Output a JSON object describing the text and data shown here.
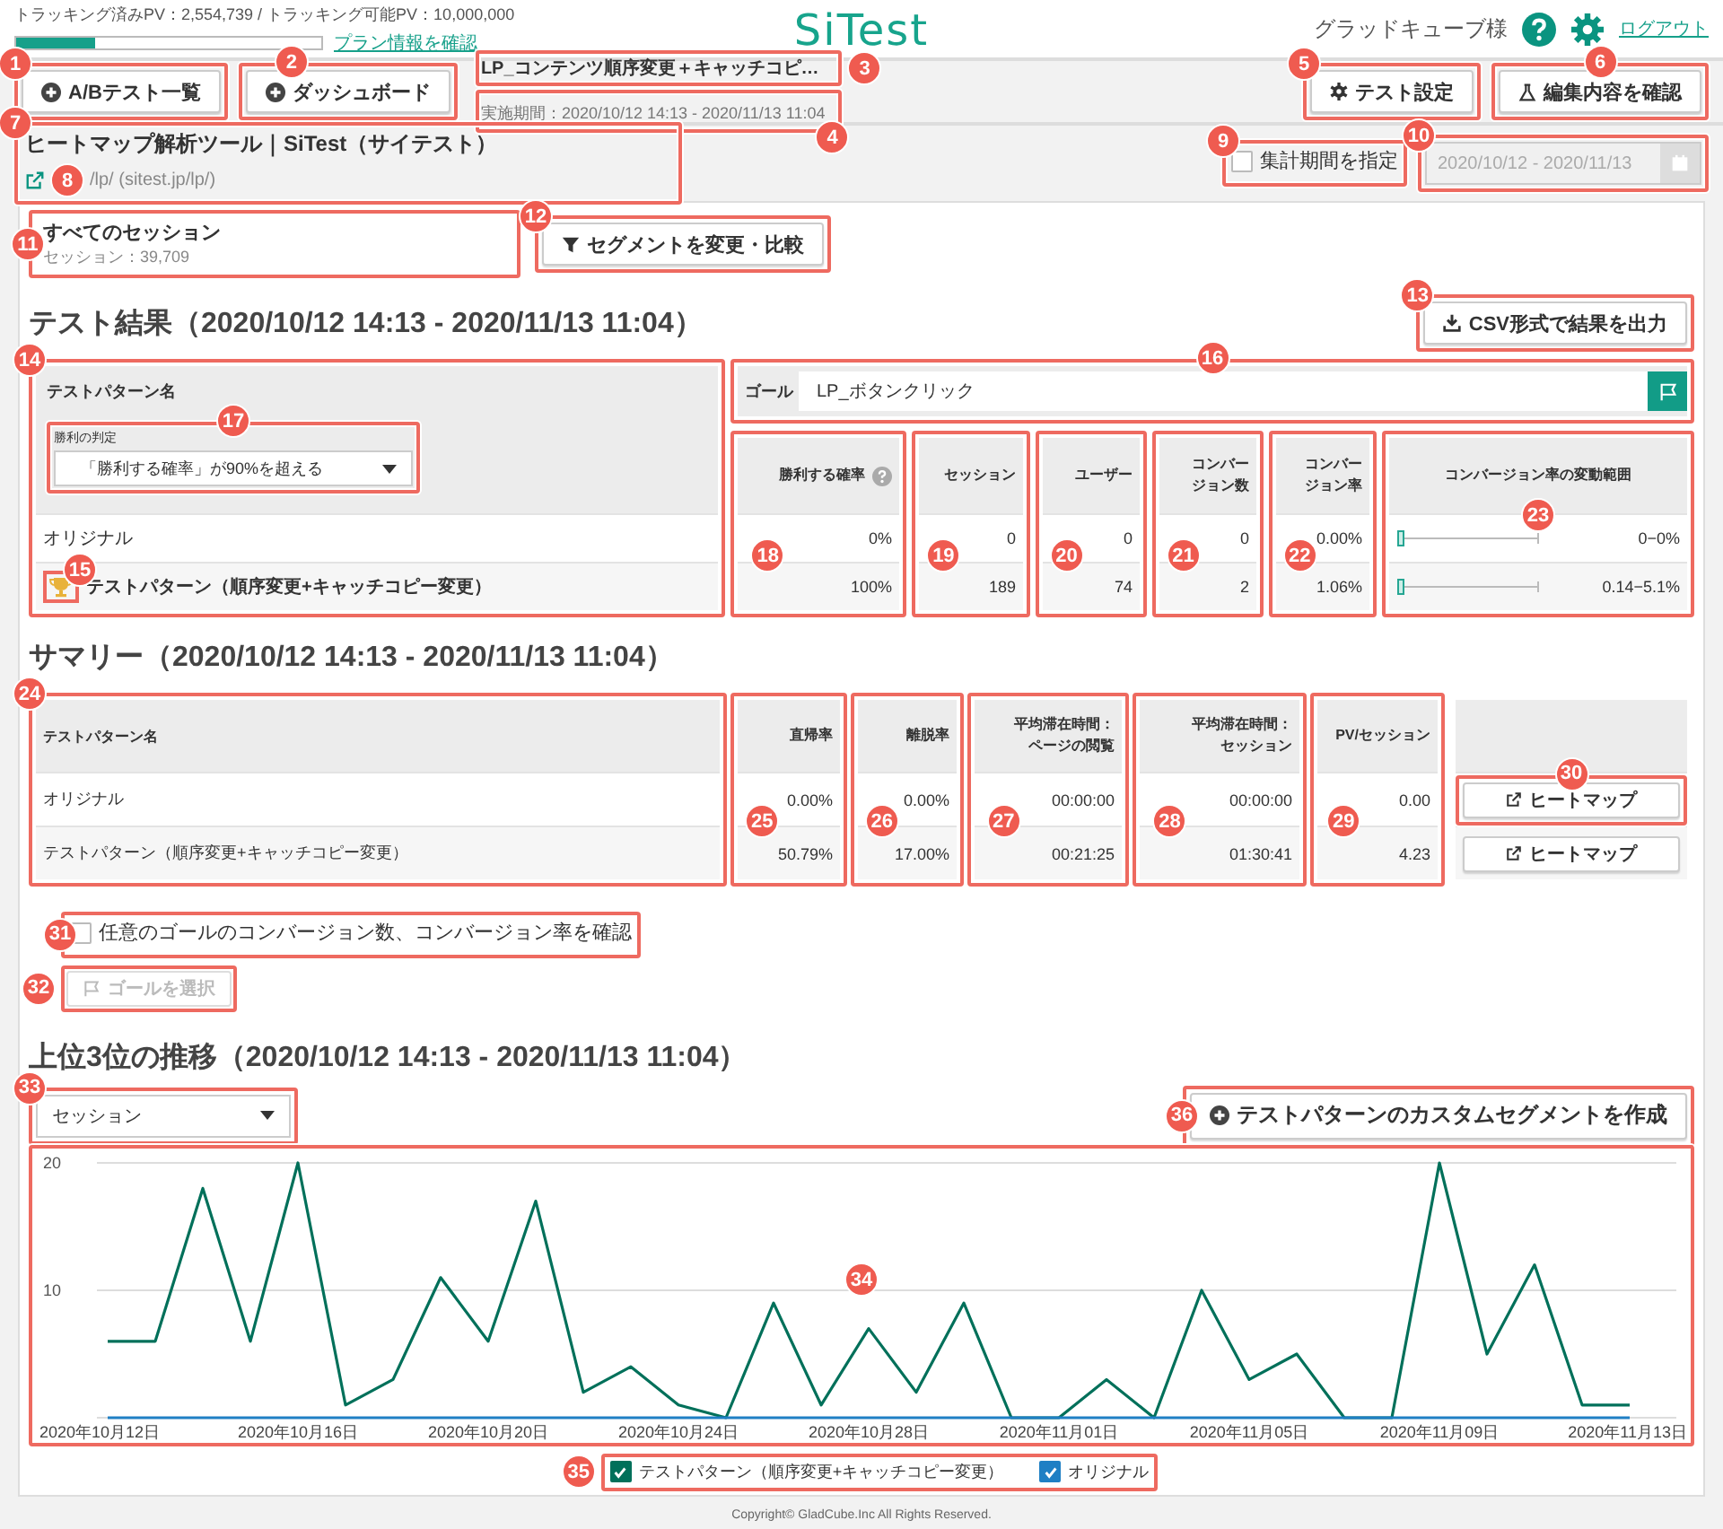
{
  "header": {
    "tracking": "トラッキング済みPV：2,554,739 / トラッキング可能PV：10,000,000",
    "usage": {
      "level": 0.26
    },
    "plan_link": "プラン情報を確認",
    "logo": "SiTest",
    "user": "グラッドキューブ様",
    "logout": "ログアウト"
  },
  "toolbar": {
    "nav_buttons": [
      {
        "label": "A/Bテスト一覧",
        "callout": "1"
      },
      {
        "label": "ダッシュボード",
        "callout": "2"
      }
    ],
    "test_title": "LP_コンテンツ順序変更＋キャッチコピ…",
    "title_callout": "3",
    "period": "実施期間：2020/10/12 14:13 - 2020/11/13 11:04",
    "period_callout": "4",
    "action_buttons": [
      {
        "kind": "settings",
        "label": "テスト設定",
        "callout": "5"
      },
      {
        "kind": "preview",
        "label": "編集内容を確認",
        "callout": "6"
      }
    ]
  },
  "page_info": {
    "title": "ヒートマップ解析ツール｜SiTest（サイテスト）",
    "callout": "7",
    "url": "/lp/ (sitest.jp/lp/)",
    "link_callout": "8",
    "period_filter": {
      "label": "集計期間を指定",
      "checked": false,
      "callout": "9"
    },
    "date_range": {
      "value": "2020/10/12 - 2020/11/13",
      "disabled": true,
      "callout": "10"
    }
  },
  "segment": {
    "title": "すべてのセッション",
    "count": "セッション：39,709",
    "callout": "11",
    "button": "セグメントを変更・比較",
    "button_callout": "12"
  },
  "results": {
    "heading": "テスト結果（2020/10/12 14:13 - 2020/11/13 11:04）",
    "csv_button": "CSV形式で結果を出力",
    "csv_callout": "13",
    "name_header": "テストパターン名",
    "name_callout": "14",
    "judge_label": "勝利の判定",
    "judge_value": "「勝利する確率」が90%を超える",
    "judge_callout": "17",
    "trophy_callout": "15",
    "rows": [
      {
        "name": "オリジナル",
        "winner": false
      },
      {
        "name": "テストパターン（順序変更+キャッチコピー変更）",
        "winner": true
      }
    ],
    "goal_label": "ゴール",
    "goal_value": "LP_ボタンクリック",
    "goal_callout": "16",
    "columns": [
      {
        "kind": "value",
        "header": [
          "勝利する確率"
        ],
        "help": true,
        "values": [
          "0%",
          "100%"
        ],
        "callout": "18"
      },
      {
        "kind": "value",
        "header": [
          "セッション"
        ],
        "help": false,
        "values": [
          "0",
          "189"
        ],
        "callout": "19"
      },
      {
        "kind": "value",
        "header": [
          "ユーザー"
        ],
        "help": false,
        "values": [
          "0",
          "74"
        ],
        "callout": "20"
      },
      {
        "kind": "value",
        "header": [
          "コンバー",
          "ジョン数"
        ],
        "help": false,
        "values": [
          "0",
          "2"
        ],
        "callout": "21"
      },
      {
        "kind": "value",
        "header": [
          "コンバー",
          "ジョン率"
        ],
        "help": false,
        "values": [
          "0.00%",
          "1.06%"
        ],
        "callout": "22"
      },
      {
        "kind": "range",
        "header": [
          "コンバージョン率の変動範囲"
        ],
        "help": false,
        "values": [
          "0−0%",
          "0.14−5.1%"
        ],
        "callout": "23"
      }
    ]
  },
  "summary": {
    "heading": "サマリー（2020/10/12 14:13 - 2020/11/13 11:04）",
    "name_header": "テストパターン名",
    "name_callout": "24",
    "rows": [
      "オリジナル",
      "テストパターン（順序変更+キャッチコピー変更）"
    ],
    "columns": [
      {
        "header": [
          "直帰率"
        ],
        "values": [
          "0.00%",
          "50.79%"
        ],
        "callout": "25"
      },
      {
        "header": [
          "離脱率"
        ],
        "values": [
          "0.00%",
          "17.00%"
        ],
        "callout": "26"
      },
      {
        "header": [
          "平均滞在時間：",
          "ページの閲覧"
        ],
        "values": [
          "00:00:00",
          "00:21:25"
        ],
        "callout": "27"
      },
      {
        "header": [
          "平均滞在時間：",
          "セッション"
        ],
        "values": [
          "00:00:00",
          "01:30:41"
        ],
        "callout": "28"
      },
      {
        "header": [
          "PV/セッション"
        ],
        "values": [
          "0.00",
          "4.23"
        ],
        "callout": "29"
      }
    ],
    "heatmap_buttons": [
      {
        "label": "ヒートマップ",
        "callout": "30"
      },
      {
        "label": "ヒートマップ"
      }
    ]
  },
  "goal_check": {
    "label": "任意のゴールのコンバージョン数、コンバージョン率を確認",
    "checked": false,
    "callout": "31",
    "button": "ゴールを選択",
    "button_disabled": true,
    "button_callout": "32"
  },
  "trend": {
    "heading": "上位3位の推移（2020/10/12 14:13 - 2020/11/13 11:04）",
    "metric": "セッション",
    "metric_callout": "33",
    "custom_button": "テストパターンのカスタムセグメントを作成",
    "custom_callout": "36",
    "chart_callout": "34",
    "legend_callout": "35",
    "legend": [
      {
        "checked": true
      },
      {
        "checked": true
      }
    ],
    "chart_data": {
      "type": "line",
      "categories": [
        "2020年10月12日",
        null,
        null,
        null,
        "2020年10月16日",
        null,
        null,
        null,
        "2020年10月20日",
        null,
        null,
        null,
        "2020年10月24日",
        null,
        null,
        null,
        "2020年10月28日",
        null,
        null,
        null,
        "2020年11月01日",
        null,
        null,
        null,
        "2020年11月05日",
        null,
        null,
        null,
        "2020年11月09日",
        null,
        null,
        null,
        "2020年11月13日"
      ],
      "series": [
        {
          "name": "テストパターン（順序変更+キャッチコピー変更）",
          "color": "#00705a",
          "values": [
            6,
            6,
            18,
            6,
            20,
            1,
            3,
            11,
            6,
            17,
            2,
            4,
            1,
            0,
            9,
            1,
            7,
            2,
            9,
            0,
            0,
            3,
            0,
            10,
            3,
            5,
            0,
            0,
            20,
            5,
            12,
            1,
            1
          ]
        },
        {
          "name": "オリジナル",
          "color": "#1f7fc4",
          "values": [
            0,
            0,
            0,
            0,
            0,
            0,
            0,
            0,
            0,
            0,
            0,
            0,
            0,
            0,
            0,
            0,
            0,
            0,
            0,
            0,
            0,
            0,
            0,
            0,
            0,
            0,
            0,
            0,
            0,
            0,
            0,
            0,
            0
          ]
        }
      ],
      "ylim": [
        0,
        20
      ],
      "yticks": [
        10,
        20
      ]
    }
  },
  "footer": "Copyright© GladCube.Inc All Rights Reserved."
}
